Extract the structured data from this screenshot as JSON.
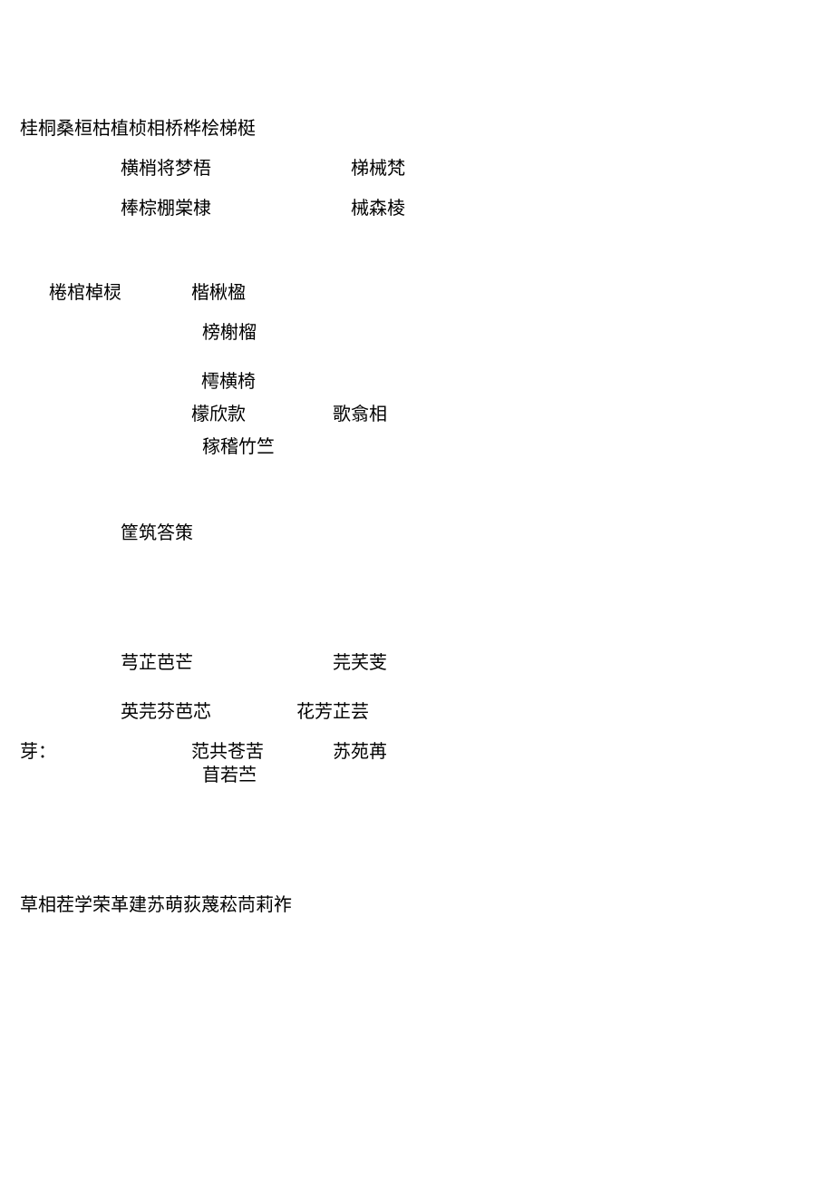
{
  "lines": {
    "l1": "桂桐桑桓枯植桢相桥桦桧梯梃",
    "l2a": "横梢将梦梧",
    "l2b": "梯械梵",
    "l3a": "棒棕棚棠棣",
    "l3b": "械森棱",
    "l4a": "棬棺棹棂",
    "l4b": "楷楸楹",
    "l5": "榜榭榴",
    "l6": "樗横椅",
    "l7a": "檬欣款",
    "l7b": "歌翕相",
    "l8": "稼稽竹竺",
    "l9": "筐筑答策",
    "l10a": "芎芷芭芒",
    "l10b": "芫芺芰",
    "l11a": "英芫芬芭芯",
    "l11b": "花芳芷芸",
    "l12a": "芽：",
    "l12b": "范共苍苦",
    "l12c": "苏苑苒",
    "l13": "苜若苎",
    "l14": "草相茬学荣革建苏萌荻蔑菘苘莉祚"
  }
}
